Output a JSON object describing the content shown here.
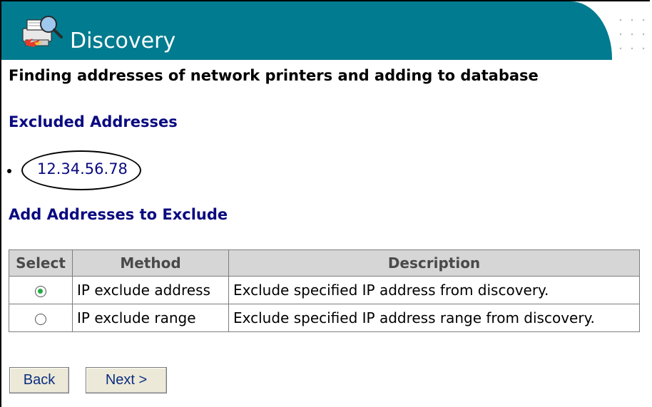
{
  "header": {
    "title": "Discovery",
    "icon": "discovery-printer-icon",
    "accent_color": "#007b8f"
  },
  "subtitle": "Finding addresses of network printers and adding to database",
  "excluded": {
    "heading": "Excluded Addresses",
    "addresses": [
      "12.34.56.78"
    ]
  },
  "add_exclude": {
    "heading": "Add Addresses to Exclude",
    "columns": [
      "Select",
      "Method",
      "Description"
    ],
    "rows": [
      {
        "selected": true,
        "method": "IP exclude address",
        "description": "Exclude specified IP address from discovery."
      },
      {
        "selected": false,
        "method": "IP exclude range",
        "description": "Exclude specified IP address range from discovery."
      }
    ]
  },
  "buttons": {
    "back": "Back",
    "next": "Next >"
  }
}
